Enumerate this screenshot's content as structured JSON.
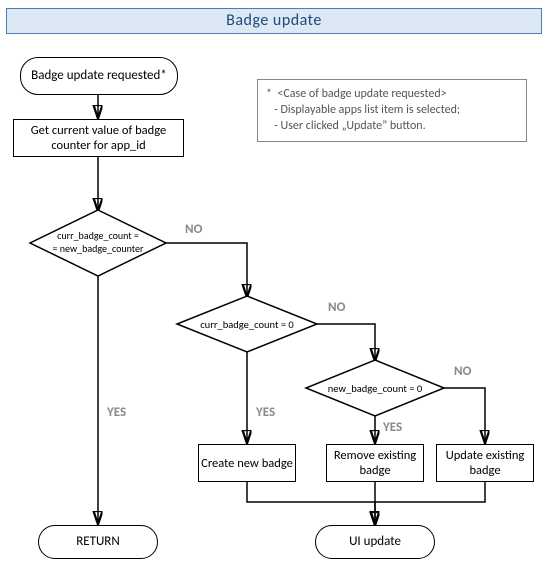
{
  "title": "Badge update",
  "nodes": {
    "start": "Badge update requested*",
    "get_value": "Get current value of badge counter for app_id",
    "d1": "curr_badge_count = = new_badge_counter",
    "d2": "curr_badge_count = 0",
    "d3": "new_badge_count = 0",
    "create": "Create new badge",
    "remove": "Remove existing badge",
    "update": "Update existing badge",
    "return": "RETURN",
    "ui_update": "UI update"
  },
  "labels": {
    "yes": "YES",
    "no": "NO"
  },
  "note": {
    "heading": "*  <Case of badge update requested>",
    "line1": "   - Displayable apps list item is selected;",
    "line2": "   - User clicked „Update” button."
  }
}
